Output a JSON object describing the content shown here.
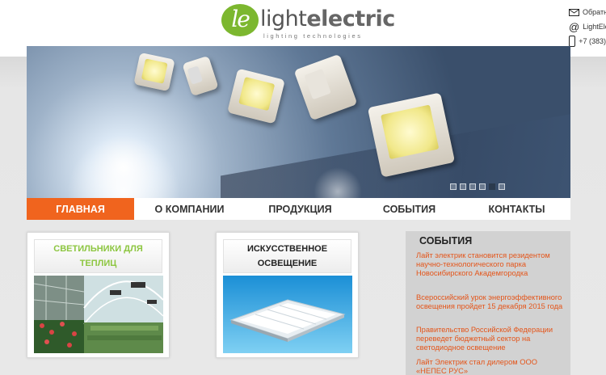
{
  "header": {
    "logo_mark": "le",
    "logo_word_light": "light",
    "logo_word_bold": "electric",
    "logo_tagline": "lighting technologies",
    "contacts": [
      {
        "icon": "envelope-icon",
        "text": "Обратная связь"
      },
      {
        "icon": "at-icon",
        "text": "LightElectric"
      },
      {
        "icon": "phone-icon",
        "text": "+7 (383)"
      }
    ]
  },
  "slider": {
    "dots_count": 6,
    "active_dot": 5
  },
  "nav": {
    "items": [
      {
        "label": "ГЛАВНАЯ",
        "active": true
      },
      {
        "label": "О КОМПАНИИ",
        "active": false
      },
      {
        "label": "ПРОДУКЦИЯ",
        "active": false
      },
      {
        "label": "СОБЫТИЯ",
        "active": false
      },
      {
        "label": "КОНТАКТЫ",
        "active": false
      }
    ]
  },
  "categories": [
    {
      "title_line1": "СВЕТИЛЬНИКИ ДЛЯ",
      "title_line2": "ТЕПЛИЦ",
      "color": "#8dc641"
    },
    {
      "title_line1": "ИСКУССТВЕННОЕ",
      "title_line2": "ОСВЕЩЕНИЕ",
      "color": "#222222"
    }
  ],
  "events": {
    "title": "СОБЫТИЯ",
    "items": [
      "Лайт электрик становится резидентом научно-технологического парка Новосибирского Академгородка",
      "Всероссийский урок энергоэффективного освещения пройдет 15 декабря 2015 года",
      "Правительство Российской Федерации переведет бюджетный сектор на светодиодное освещение",
      "Лайт Электрик стал дилером ООО «НЕПЕС РУС»"
    ]
  },
  "colors": {
    "accent": "#f0641e",
    "brand_green": "#7cb72f",
    "event_link": "#e4551a"
  }
}
